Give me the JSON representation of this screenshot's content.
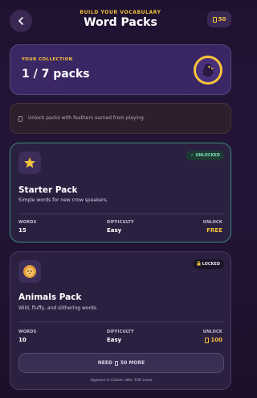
{
  "header": {
    "back_icon": "chevron-left-icon",
    "kicker": "BUILD YOUR VOCABULARY",
    "title": "Word Packs",
    "feather_count": "50"
  },
  "collection": {
    "label": "YOUR COLLECTION",
    "value": "1 / 7 packs",
    "avatar_icon": "crow-icon"
  },
  "banner": {
    "text": "Unlock packs with feathers earned from playing."
  },
  "packs": [
    {
      "status": "UNLOCKED",
      "icon": "star-icon",
      "name": "Starter Pack",
      "description": "Simple words for new crow speakers.",
      "words_label": "WORDS",
      "words": "15",
      "difficulty_label": "DIFFICULTY",
      "difficulty": "Easy",
      "unlock_label": "UNLOCK",
      "unlock": "FREE"
    },
    {
      "status": "LOCKED",
      "icon": "lion-icon",
      "name": "Animals Pack",
      "description": "Wild, fluffy, and slithering words.",
      "words_label": "WORDS",
      "words": "10",
      "difficulty_label": "DIFFICULTY",
      "difficulty": "Easy",
      "unlock_label": "UNLOCK",
      "unlock": "100",
      "button": "NEED ",
      "button_suffix": "50 MORE",
      "footnote": "Appears in Classic after 100 score"
    }
  ],
  "colors": {
    "accent": "#f5c33b",
    "unlocked_border": "#3c8c7c",
    "background": "#1f1230"
  }
}
